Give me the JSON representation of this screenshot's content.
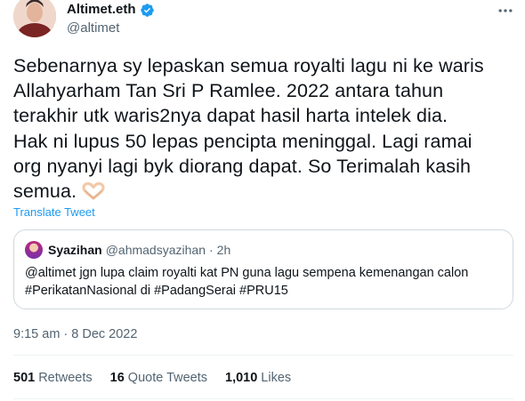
{
  "author": {
    "display_name": "Altimet.eth",
    "handle": "@altimet",
    "verified_icon": "verified-badge-icon",
    "avatar_icon": "profile-avatar"
  },
  "tweet": {
    "lines": [
      "Sebenarnya sy lepaskan semua royalti lagu ni ke waris",
      "Allahyarham Tan Sri P Ramlee. 2022 antara tahun",
      "terakhir utk waris2nya dapat hasil harta intelek dia.",
      "Hak ni lupus 50 lepas pencipta meninggal. Lagi ramai",
      "org nyanyi lagi byk diorang dapat. So Terimalah kasih",
      "semua."
    ],
    "emoji_icon": "heart-hands-icon",
    "translate_label": "Translate Tweet"
  },
  "quote": {
    "display_name": "Syazihan",
    "handle": "@ahmadsyazihan",
    "separator": "·",
    "time": "2h",
    "lines": [
      "@altimet jgn lupa claim royalti kat PN guna lagu sempena kemenangan calon",
      "#PerikatanNasional di #PadangSerai #PRU15"
    ]
  },
  "meta": {
    "time": "9:15 am",
    "separator": "·",
    "date": "8 Dec 2022"
  },
  "stats": {
    "retweets_count": "501",
    "retweets_label": "Retweets",
    "quotes_count": "16",
    "quotes_label": "Quote Tweets",
    "likes_count": "1,010",
    "likes_label": "Likes"
  },
  "colors": {
    "text": "#0f1419",
    "secondary": "#536471",
    "link": "#1d9bf0",
    "border": "#cfd9de"
  }
}
